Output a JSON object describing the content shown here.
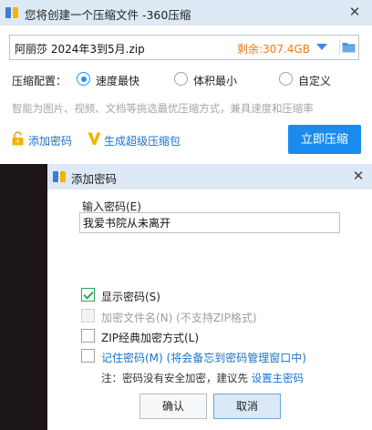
{
  "main_window": {
    "title": "您将创建一个压缩文件 -360压缩",
    "close_symbol": "✕",
    "file_name": "阿丽莎 2024年3到5月.zip",
    "free_space": "剩余:307.4GB",
    "config_label": "压缩配置：",
    "options": [
      {
        "label": "速度最快",
        "checked": true
      },
      {
        "label": "体积最小",
        "checked": false
      },
      {
        "label": "自定义",
        "checked": false
      }
    ],
    "hint": "智能为图片、视频、文档等挑选最优压缩方式，兼具速度和压缩率",
    "add_password_link": "添加密码",
    "super_package_link": "生成超级压缩包",
    "compress_button": "立即压缩",
    "icons": {
      "app": "360-zip-icon",
      "dropdown": "triangle-down-icon",
      "folder": "folder-icon",
      "lock": "lock-icon",
      "vip": "vip-v-icon"
    },
    "colors": {
      "accent": "#1a8cf0",
      "free_space": "#f07b14",
      "link": "#1a73c8"
    }
  },
  "dialog": {
    "title": "添加密码",
    "close_symbol": "✕",
    "password_label": "输入密码(E)",
    "password_value": "我爱书院从未离开",
    "checkboxes": [
      {
        "label": "显示密码(S)",
        "checked": true,
        "disabled": false
      },
      {
        "label": "加密文件名(N) (不支持ZIP格式)",
        "checked": false,
        "disabled": true
      },
      {
        "label": "ZIP经典加密方式(L)",
        "checked": false,
        "disabled": false
      },
      {
        "label": "记住密码(M) (将会备忘到密码管理窗口中)",
        "checked": false,
        "disabled": false
      }
    ],
    "note_text": "注：密码没有安全加密，建议先 ",
    "note_link": "设置主密码",
    "ok_button": "确认",
    "cancel_button": "取消"
  }
}
